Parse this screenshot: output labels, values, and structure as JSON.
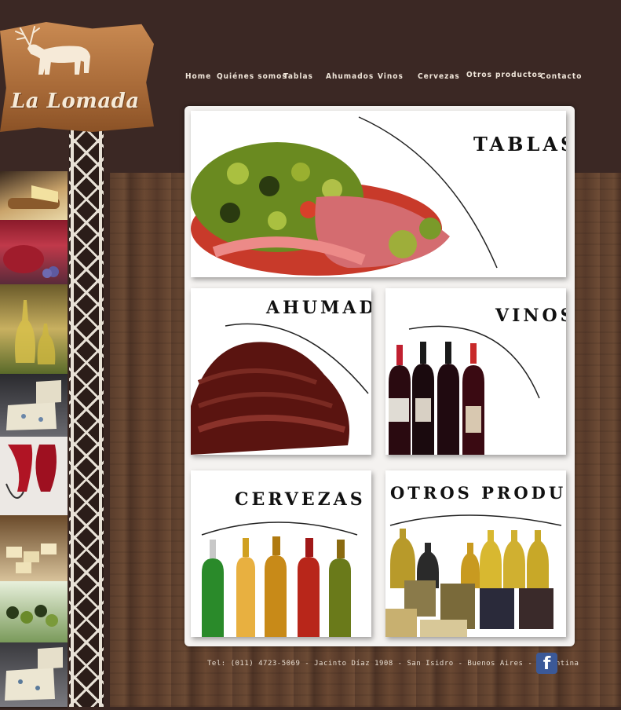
{
  "brand": {
    "name": "La Lomada"
  },
  "nav": {
    "items": [
      {
        "label": "Home"
      },
      {
        "label": "Quiénes somos"
      },
      {
        "label": "Tablas"
      },
      {
        "label": "Ahumados"
      },
      {
        "label": "Vinos"
      },
      {
        "label": "Cervezas"
      },
      {
        "label": "Otros productos"
      },
      {
        "label": "Contacto"
      }
    ]
  },
  "cards": {
    "tablas": {
      "title": "TABLAS"
    },
    "ahumados": {
      "title": "AHUMADOS"
    },
    "vinos": {
      "title": "VINOS"
    },
    "cervezas": {
      "title": "CERVEZAS"
    },
    "otros": {
      "title": "OTROS PRODUCTOS"
    }
  },
  "footer": {
    "contact": "Tel: (011) 4723-5069 - Jacinto Díaz 1908 - San Isidro - Buenos Aires - Argentina",
    "facebook_icon": "facebook-icon",
    "facebook_glyph": "f"
  },
  "colors": {
    "background": "#3b2824",
    "wood": "#5a3d2c",
    "panel": "#f4f2f0",
    "facebook": "#3b5998"
  },
  "sidebar_thumbs": [
    {
      "name": "cheese-board-thumb"
    },
    {
      "name": "cold-cuts-thumb"
    },
    {
      "name": "olive-oil-thumb"
    },
    {
      "name": "blue-cheese-thumb"
    },
    {
      "name": "red-wine-thumb"
    },
    {
      "name": "cheese-cubes-thumb"
    },
    {
      "name": "olives-thumb"
    },
    {
      "name": "blue-cheese-2-thumb"
    }
  ]
}
